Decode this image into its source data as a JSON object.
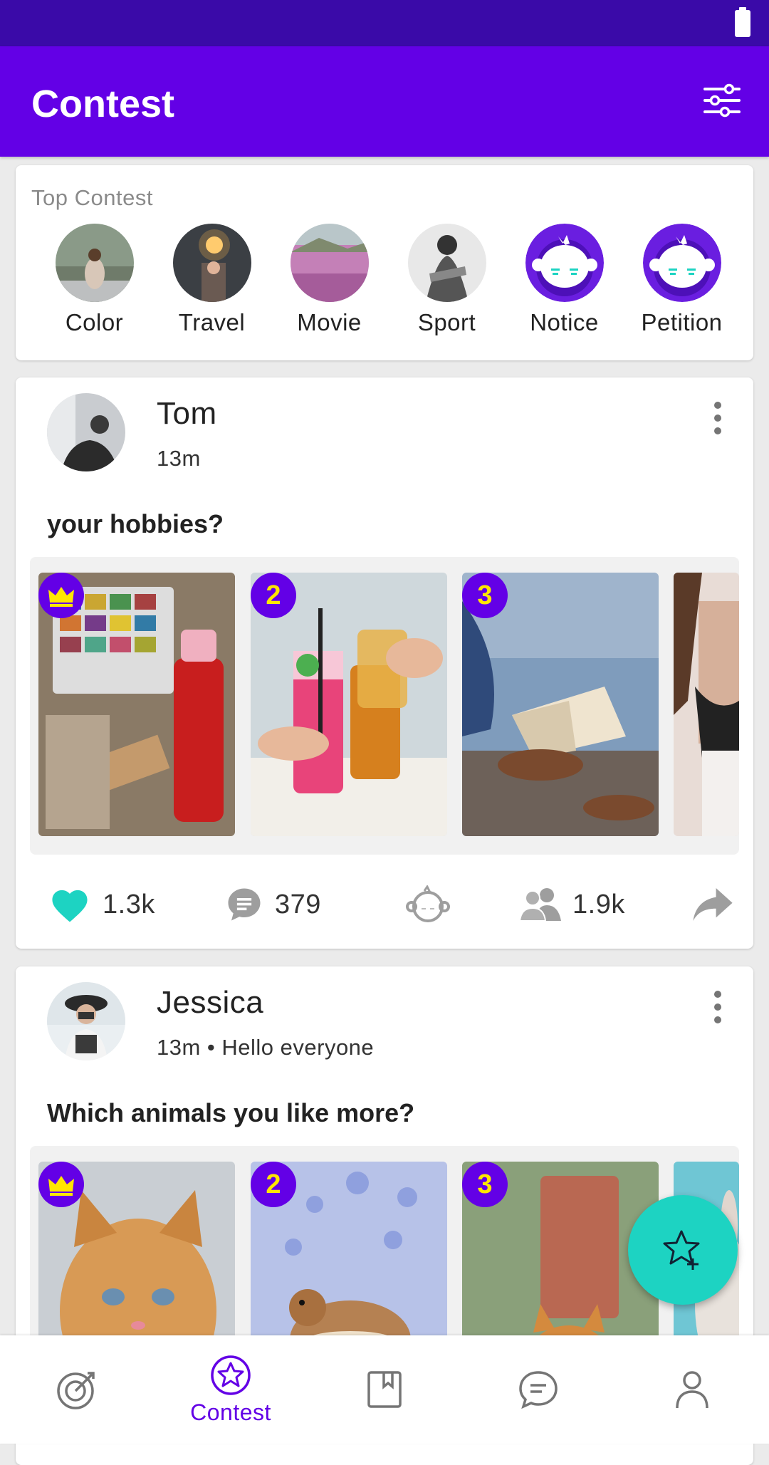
{
  "app": {
    "title": "Contest",
    "accent_color": "#6300e6",
    "status_bar_color": "#3a0aa8",
    "secondary_color": "#1dd3c2"
  },
  "top_contest": {
    "label": "Top Contest",
    "categories": [
      {
        "name": "Color",
        "icon": "photo-thumbnail"
      },
      {
        "name": "Travel",
        "icon": "photo-thumbnail"
      },
      {
        "name": "Movie",
        "icon": "photo-thumbnail"
      },
      {
        "name": "Sport",
        "icon": "photo-thumbnail"
      },
      {
        "name": "Notice",
        "icon": "monkey-logo-icon"
      },
      {
        "name": "Petition",
        "icon": "monkey-logo-icon"
      }
    ]
  },
  "posts": [
    {
      "author": "Tom",
      "meta": "13m",
      "question": "your hobbies?",
      "photos": [
        {
          "rank": "crown",
          "subject": "paints"
        },
        {
          "rank": "2",
          "subject": "drinks"
        },
        {
          "rank": "3",
          "subject": "reading"
        },
        {
          "rank": "",
          "subject": "person"
        }
      ],
      "stats": {
        "likes": "1.3k",
        "comments": "379",
        "participants": "1.9k"
      }
    },
    {
      "author": "Jessica",
      "meta": "13m • Hello everyone",
      "question": "Which animals you like more?",
      "photos": [
        {
          "rank": "crown",
          "subject": "kitten"
        },
        {
          "rank": "2",
          "subject": "chipmunk"
        },
        {
          "rank": "3",
          "subject": "corgi"
        },
        {
          "rank": "",
          "subject": "rabbit"
        }
      ]
    }
  ],
  "bottom_nav": {
    "items": [
      {
        "icon": "target-icon",
        "label": ""
      },
      {
        "icon": "star-badge-icon",
        "label": "Contest",
        "active": true
      },
      {
        "icon": "bookmark-icon",
        "label": ""
      },
      {
        "icon": "chat-icon",
        "label": ""
      },
      {
        "icon": "profile-icon",
        "label": ""
      }
    ]
  }
}
